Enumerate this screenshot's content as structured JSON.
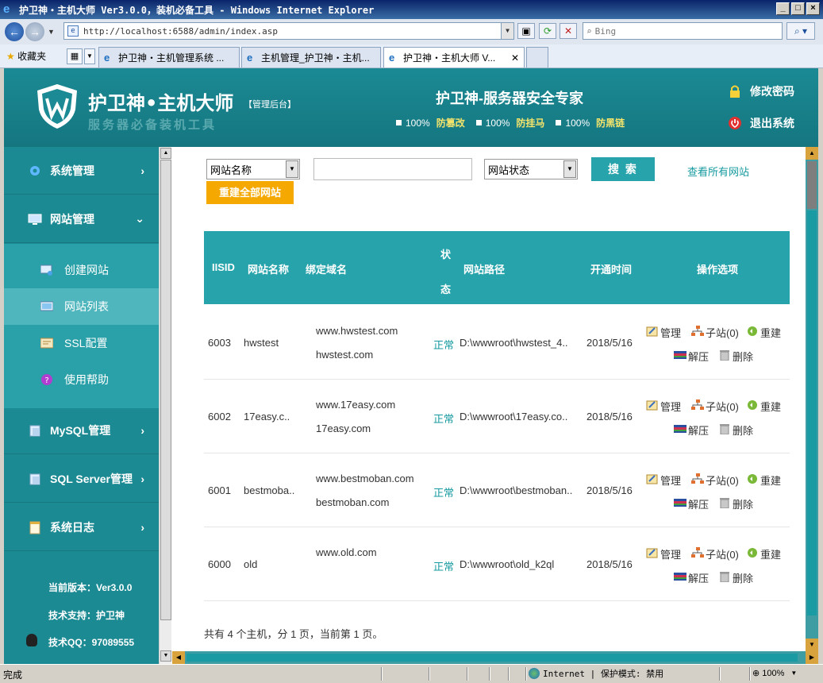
{
  "browser": {
    "title": "护卫神・主机大师 Ver3.0.0，装机必备工具 - Windows Internet Explorer",
    "url": "http://localhost:6588/admin/index.asp",
    "search_placeholder": "Bing",
    "favorites_label": "收藏夹",
    "tabs": [
      {
        "label": "护卫神・主机管理系统 ..."
      },
      {
        "label": "主机管理_护卫神・主机..."
      },
      {
        "label": "护卫神・主机大师 V..."
      }
    ],
    "status": {
      "left": "完成",
      "zone": "Internet | 保护模式: 禁用",
      "zoom": "100%"
    }
  },
  "header": {
    "brand": "护卫神•主机大师",
    "badge": "【管理后台】",
    "subtitle": "服务器必备装机工具",
    "center_title": "护卫神-服务器安全专家",
    "guards": [
      {
        "pct": "100%",
        "label": "防篡改"
      },
      {
        "pct": "100%",
        "label": "防挂马"
      },
      {
        "pct": "100%",
        "label": "防黑链"
      }
    ],
    "change_password": "修改密码",
    "logout": "退出系统"
  },
  "sidebar": {
    "menus": [
      {
        "label": "系统管理"
      },
      {
        "label": "网站管理"
      },
      {
        "label": "MySQL管理"
      },
      {
        "label": "SQL Server管理"
      },
      {
        "label": "系统日志"
      }
    ],
    "sub_items": [
      {
        "label": "创建网站"
      },
      {
        "label": "网站列表"
      },
      {
        "label": "SSL配置"
      },
      {
        "label": "使用帮助"
      }
    ],
    "version": "当前版本：Ver3.0.0",
    "support": "技术支持：护卫神",
    "qq": "技术QQ：97089555"
  },
  "filters": {
    "field_select": "网站名称",
    "keyword": "",
    "status_select": "网站状态",
    "search_label": "搜 索",
    "view_all": "查看所有网站",
    "rebuild_all": "重建全部网站"
  },
  "table": {
    "headers": {
      "iisid": "IISID",
      "name": "网站名称",
      "domain": "绑定域名",
      "status_1": "状",
      "status_2": "态",
      "path": "网站路径",
      "date": "开通时间",
      "ops": "操作选项"
    },
    "op_labels": {
      "manage": "管理",
      "subsite": "子站(0)",
      "rebuild": "重建",
      "unzip": "解压",
      "delete": "删除"
    },
    "rows": [
      {
        "id": "6003",
        "name": "hwstest",
        "domain1": "www.hwstest.com",
        "domain2": "hwstest.com",
        "status": "正常",
        "path": "D:\\wwwroot\\hwstest_4..",
        "date": "2018/5/16"
      },
      {
        "id": "6002",
        "name": "17easy.c..",
        "domain1": "www.17easy.com",
        "domain2": "17easy.com",
        "status": "正常",
        "path": "D:\\wwwroot\\17easy.co..",
        "date": "2018/5/16"
      },
      {
        "id": "6001",
        "name": "bestmoba..",
        "domain1": "www.bestmoban.com",
        "domain2": "bestmoban.com",
        "status": "正常",
        "path": "D:\\wwwroot\\bestmoban..",
        "date": "2018/5/16"
      },
      {
        "id": "6000",
        "name": "old",
        "domain1": "www.old.com",
        "domain2": "",
        "status": "正常",
        "path": "D:\\wwwroot\\old_k2ql",
        "date": "2018/5/16"
      }
    ]
  },
  "summary": "共有 4 个主机，分 1 页，当前第 1 页。",
  "colors": {
    "header_bg": "#1b8a94",
    "sidebar_bg": "#1c8a93",
    "table_head": "#27a3ac",
    "accent_orange": "#f5a800",
    "guard_label": "#f4e46b"
  }
}
